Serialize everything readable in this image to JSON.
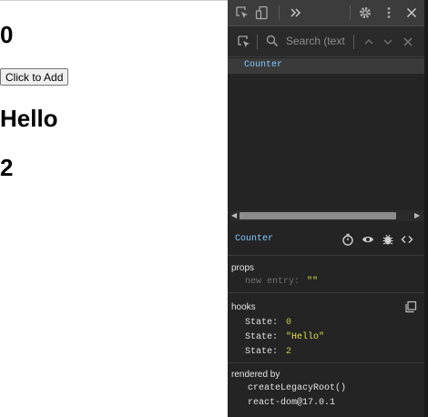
{
  "app": {
    "count": "0",
    "button_label": "Click to Add",
    "greeting": "Hello",
    "second_value": "2"
  },
  "devtools": {
    "toolbar": {
      "icons": [
        "inspect-element-icon",
        "device-toggle-icon",
        "more-tabs-icon",
        "settings-icon",
        "kebab-menu-icon",
        "close-icon"
      ]
    },
    "search": {
      "placeholder": "Search (text"
    },
    "tree": {
      "selected_component": "Counter"
    },
    "component": {
      "name": "Counter",
      "icons": [
        "stopwatch-icon",
        "eye-icon",
        "bug-icon",
        "source-icon"
      ]
    },
    "props": {
      "title": "props",
      "new_entry_key": "new entry:",
      "new_entry_value": "\"\""
    },
    "hooks": {
      "title": "hooks",
      "items": [
        {
          "key": "State:",
          "value": "0"
        },
        {
          "key": "State:",
          "value": "\"Hello\""
        },
        {
          "key": "State:",
          "value": "2"
        }
      ]
    },
    "rendered_by": {
      "title": "rendered by",
      "items": [
        "createLegacyRoot()",
        "react-dom@17.0.1"
      ]
    },
    "colors": {
      "panel_bg": "#242424",
      "component_name": "#80cbff",
      "number": "#c9c94a",
      "string": "#e0e04e"
    }
  }
}
